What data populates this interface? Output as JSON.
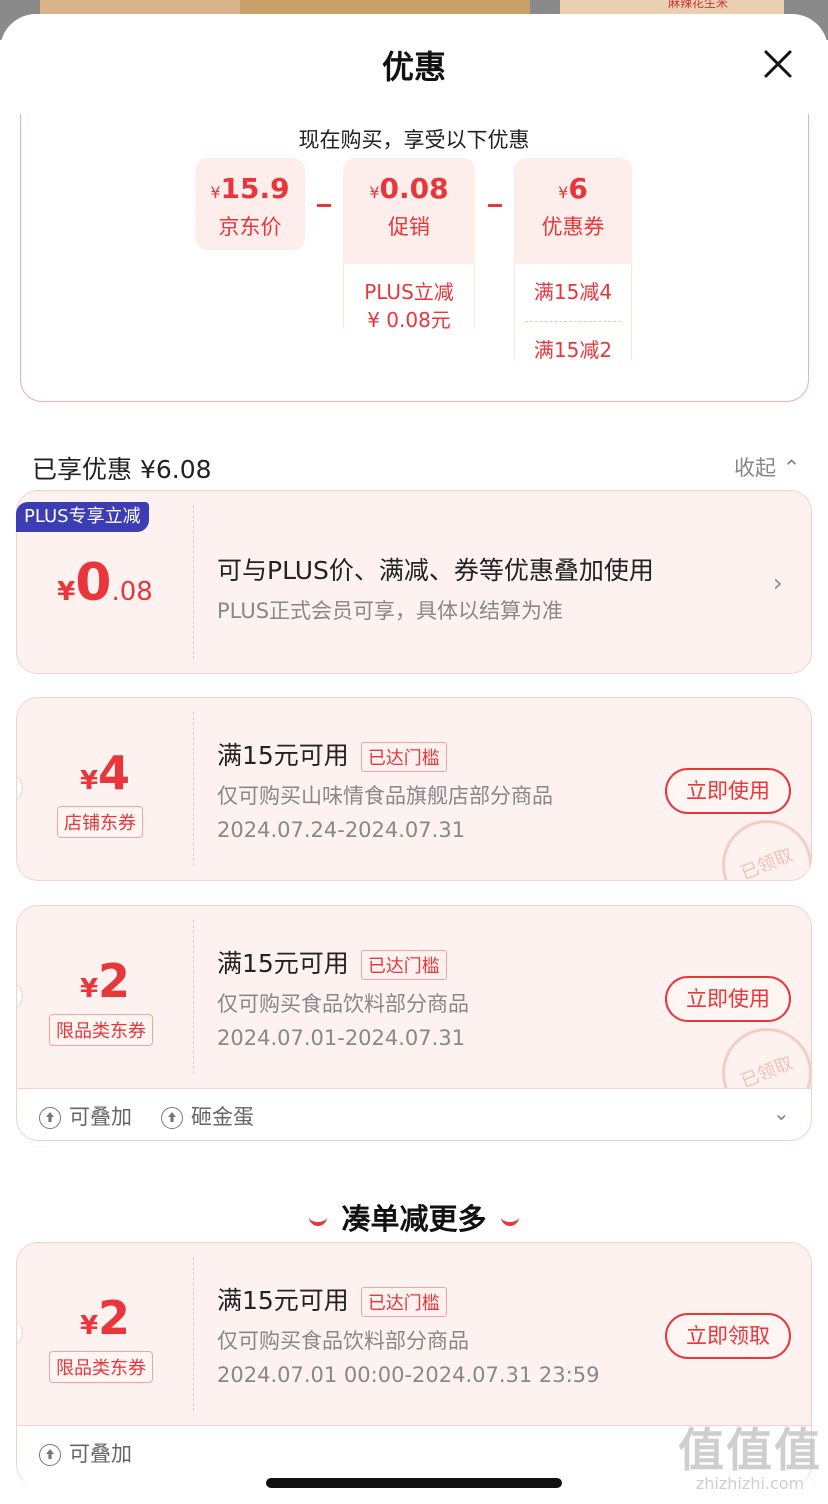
{
  "behind_page": {
    "snippet": "麻辣花生米"
  },
  "sheet": {
    "title": "优惠",
    "close_icon": "close-icon"
  },
  "summary": {
    "heading": "现在购买，享受以下优惠",
    "jd_price": {
      "currency": "¥",
      "amount": "15.9",
      "label": "京东价"
    },
    "promo": {
      "currency": "¥",
      "amount": "0.08",
      "label": "促销",
      "detail_line1": "PLUS立减",
      "detail_line2": "¥ 0.08元"
    },
    "coupon": {
      "currency": "¥",
      "amount": "6",
      "label": "优惠券",
      "detail_line1": "满15减4",
      "detail_line2": "满15减2"
    }
  },
  "enjoyed": {
    "label": "已享优惠 ¥6.08",
    "collapse": "收起"
  },
  "plus_card": {
    "badge": "PLUS专享立减",
    "currency": "¥",
    "amount_int": "0",
    "amount_dec": ".08",
    "main": "可与PLUS价、满减、券等优惠叠加使用",
    "sub": "PLUS正式会员可享，具体以结算为准"
  },
  "coupons": [
    {
      "currency": "¥",
      "amount": "4",
      "tag": "店铺东券",
      "main": "满15元可用",
      "reached": "已达门槛",
      "sub": "仅可购买山味情食品旗舰店部分商品",
      "date": "2024.07.24-2024.07.31",
      "button": "立即使用",
      "stamp": "已领取"
    },
    {
      "currency": "¥",
      "amount": "2",
      "tag": "限品类东券",
      "main": "满15元可用",
      "reached": "已达门槛",
      "sub": "仅可购买食品饮料部分商品",
      "date": "2024.07.01-2024.07.31",
      "button": "立即使用",
      "stamp": "已领取"
    }
  ],
  "footer": {
    "stackable": "可叠加",
    "golden_egg": "砸金蛋"
  },
  "more_section": {
    "title": "凑单减更多"
  },
  "more_coupon": {
    "currency": "¥",
    "amount": "2",
    "tag": "限品类东券",
    "main": "满15元可用",
    "reached": "已达门槛",
    "sub": "仅可购买食品饮料部分商品",
    "date": "2024.07.01 00:00-2024.07.31 23:59",
    "button": "立即领取",
    "stackable": "可叠加"
  },
  "watermark": {
    "big": "值值值",
    "small": "zhizhizhi.com"
  },
  "colors": {
    "accent": "#e8363a",
    "card_bg": "#fdf2f0",
    "badge_blue": "#3c3cb4"
  }
}
